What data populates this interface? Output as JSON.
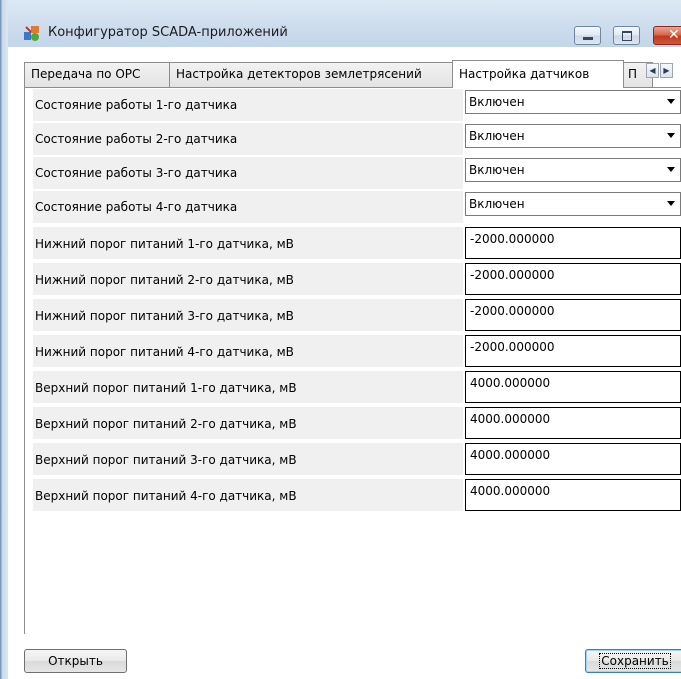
{
  "window": {
    "title": "Конфигуратор SCADA-приложений"
  },
  "tabs": [
    {
      "label": "Передача по OPC"
    },
    {
      "label": "Настройка детекторов землетрясений"
    },
    {
      "label": "Настройка датчиков"
    },
    {
      "label": "П"
    }
  ],
  "icons": {
    "app": "scada-app-icon",
    "minimize": "minimize-icon",
    "maximize": "maximize-icon",
    "close": "close-icon",
    "tab_left": "chevron-left-icon",
    "tab_right": "chevron-right-icon",
    "dropdown": "chevron-down-icon"
  },
  "settings": [
    {
      "label": "Состояние работы 1-го датчика",
      "type": "select",
      "value": "Включен"
    },
    {
      "label": "Состояние работы 2-го датчика",
      "type": "select",
      "value": "Включен"
    },
    {
      "label": "Состояние работы 3-го датчика",
      "type": "select",
      "value": "Включен"
    },
    {
      "label": "Состояние работы 4-го датчика",
      "type": "select",
      "value": "Включен"
    },
    {
      "label": "Нижний порог питаний 1-го датчика, мВ",
      "type": "text",
      "value": "-2000.000000"
    },
    {
      "label": "Нижний порог питаний 2-го датчика, мВ",
      "type": "text",
      "value": "-2000.000000"
    },
    {
      "label": "Нижний порог питаний 3-го датчика, мВ",
      "type": "text",
      "value": "-2000.000000"
    },
    {
      "label": "Нижний порог питаний 4-го датчика, мВ",
      "type": "text",
      "value": "-2000.000000"
    },
    {
      "label": "Верхний порог питаний 1-го датчика, мВ",
      "type": "text",
      "value": "4000.000000"
    },
    {
      "label": "Верхний порог питаний 2-го датчика, мВ",
      "type": "text",
      "value": "4000.000000"
    },
    {
      "label": "Верхний порог питаний 3-го датчика, мВ",
      "type": "text",
      "value": "4000.000000"
    },
    {
      "label": "Верхний порог питаний 4-го датчика, мВ",
      "type": "text",
      "value": "4000.000000"
    }
  ],
  "buttons": {
    "open": "Открыть",
    "save": "Сохранить"
  },
  "colors": {
    "close_button": "#c2391c",
    "label_background": "#f0f0f0",
    "titlebar": "#cfdeee"
  }
}
